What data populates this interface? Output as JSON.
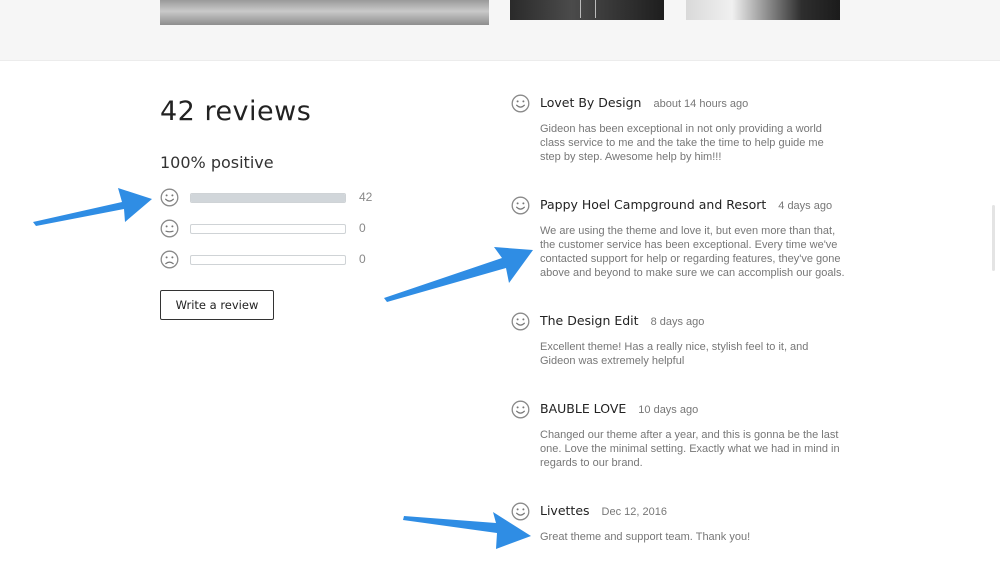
{
  "colors": {
    "arrow": "#2f8de4",
    "bar_fill": "#d1d6da",
    "text_muted": "#777777"
  },
  "summary": {
    "title": "42 reviews",
    "positive": "100% positive",
    "ratings": [
      {
        "type": "positive",
        "icon": "smiley-face-icon",
        "count": "42",
        "fraction": 1.0
      },
      {
        "type": "neutral",
        "icon": "neutral-face-icon",
        "count": "0",
        "fraction": 0
      },
      {
        "type": "negative",
        "icon": "sad-face-icon",
        "count": "0",
        "fraction": 0
      }
    ],
    "write_review_label": "Write a review"
  },
  "reviews": [
    {
      "name": "Lovet By Design",
      "date": "about 14 hours ago",
      "body": "Gideon has been exceptional in not only providing a world class service to me and the take the time to help guide me step by step. Awesome help by him!!!"
    },
    {
      "name": "Pappy Hoel Campground and Resort",
      "date": "4 days ago",
      "body": "We are using the theme and love it, but even more than that, the customer service has been exceptional. Every time we've contacted support for help or regarding features, they've gone above and beyond to make sure we can accomplish our goals."
    },
    {
      "name": "The Design Edit",
      "date": "8 days ago",
      "body": "Excellent theme! Has a really nice, stylish feel to it, and Gideon was extremely helpful"
    },
    {
      "name": "BAUBLE LOVE",
      "date": "10 days ago",
      "body": "Changed our theme after a year, and this is gonna be the last one. Love the minimal setting. Exactly what we had in mind in regards to our brand."
    },
    {
      "name": "Livettes",
      "date": "Dec 12, 2016",
      "body": "Great theme and support team. Thank you!"
    }
  ]
}
